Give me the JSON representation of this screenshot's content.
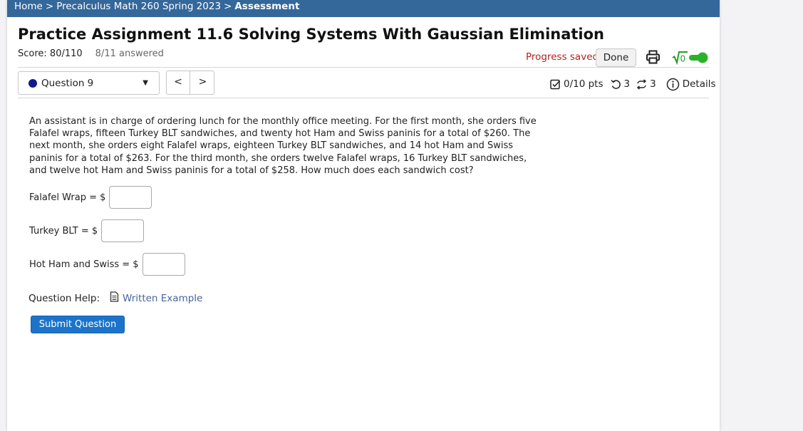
{
  "breadcrumb": {
    "home": "Home",
    "course": "Precalculus Math 260 Spring 2023",
    "current": "Assessment",
    "separator": ">"
  },
  "assignment": {
    "title": "Practice Assignment 11.6 Solving Systems With Gaussian Elimination",
    "score": "Score: 80/110",
    "answered": "8/11 answered"
  },
  "header_actions": {
    "progress_status": "Progress saved",
    "done_label": "Done",
    "math_toggle_icon": "sqrt-icon",
    "toggle_on": true
  },
  "question_nav": {
    "selected": "Question 9",
    "status_color": "#101a8c",
    "prev_symbol": "<",
    "next_symbol": ">"
  },
  "question_meta": {
    "points": "0/10 pts",
    "retries": "3",
    "attempts": "3",
    "details_label": "Details"
  },
  "question": {
    "text": "An assistant is in charge of ordering lunch for the monthly office meeting. For the first month, she orders five Falafel wraps, fifteen Turkey BLT sandwiches, and twenty hot Ham and Swiss paninis for a total of $260. The next month, she orders eight Falafel wraps, eighteen Turkey BLT sandwiches, and 14 hot Ham and Swiss paninis for a total of $263. For the third month, she orders twelve Falafel wraps, 16 Turkey BLT sandwiches, and twelve hot Ham and Swiss paninis for a total of $258. How much does each sandwich cost?",
    "answers": [
      {
        "label": "Falafel Wrap = $",
        "value": ""
      },
      {
        "label": "Turkey BLT = $",
        "value": ""
      },
      {
        "label": "Hot Ham and Swiss = $",
        "value": ""
      }
    ]
  },
  "help": {
    "label": "Question Help:",
    "link": "Written Example"
  },
  "submit_label": "Submit Question",
  "colors": {
    "topbar": "#34679a",
    "progress_saved": "#b52020",
    "toggle": "#2bb22b",
    "submit": "#1b74c9",
    "link": "#4863a0"
  }
}
